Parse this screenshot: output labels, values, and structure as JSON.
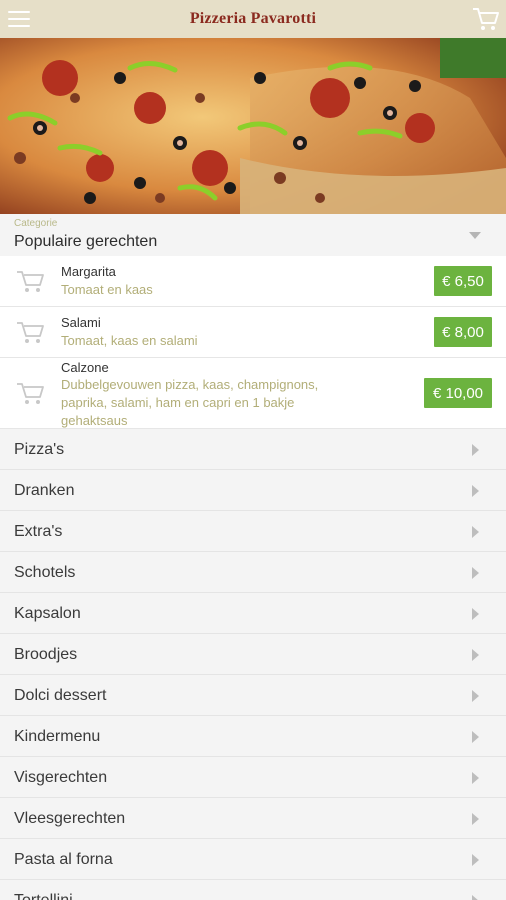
{
  "header": {
    "logo_text": "Pizzeria Pavarotti",
    "menu_icon": "hamburger-menu-icon",
    "cart_icon": "cart-icon"
  },
  "hero": {
    "image": "pizza-photo"
  },
  "category_picker": {
    "caption": "Categorie",
    "selected": "Populaire gerechten"
  },
  "products": [
    {
      "name": "Margarita",
      "description": "Tomaat en kaas",
      "price": "€ 6,50"
    },
    {
      "name": "Salami",
      "description": "Tomaat, kaas en salami",
      "price": "€ 8,00"
    },
    {
      "name": "Calzone",
      "description": "Dubbelgevouwen pizza, kaas, champignons, paprika, salami, ham en capri en 1 bakje gehaktsaus",
      "price": "€ 10,00"
    }
  ],
  "categories": [
    "Pizza's",
    "Dranken",
    "Extra's",
    "Schotels",
    "Kapsalon",
    "Broodjes",
    "Dolci dessert",
    "Kindermenu",
    "Visgerechten",
    "Vleesgerechten",
    "Pasta al forna",
    "Tortellini"
  ],
  "colors": {
    "topbar": "#e6dfc8",
    "price_green": "#6cb33f",
    "logo_red": "#8b2a1f",
    "desc_olive": "#b2ae78"
  }
}
